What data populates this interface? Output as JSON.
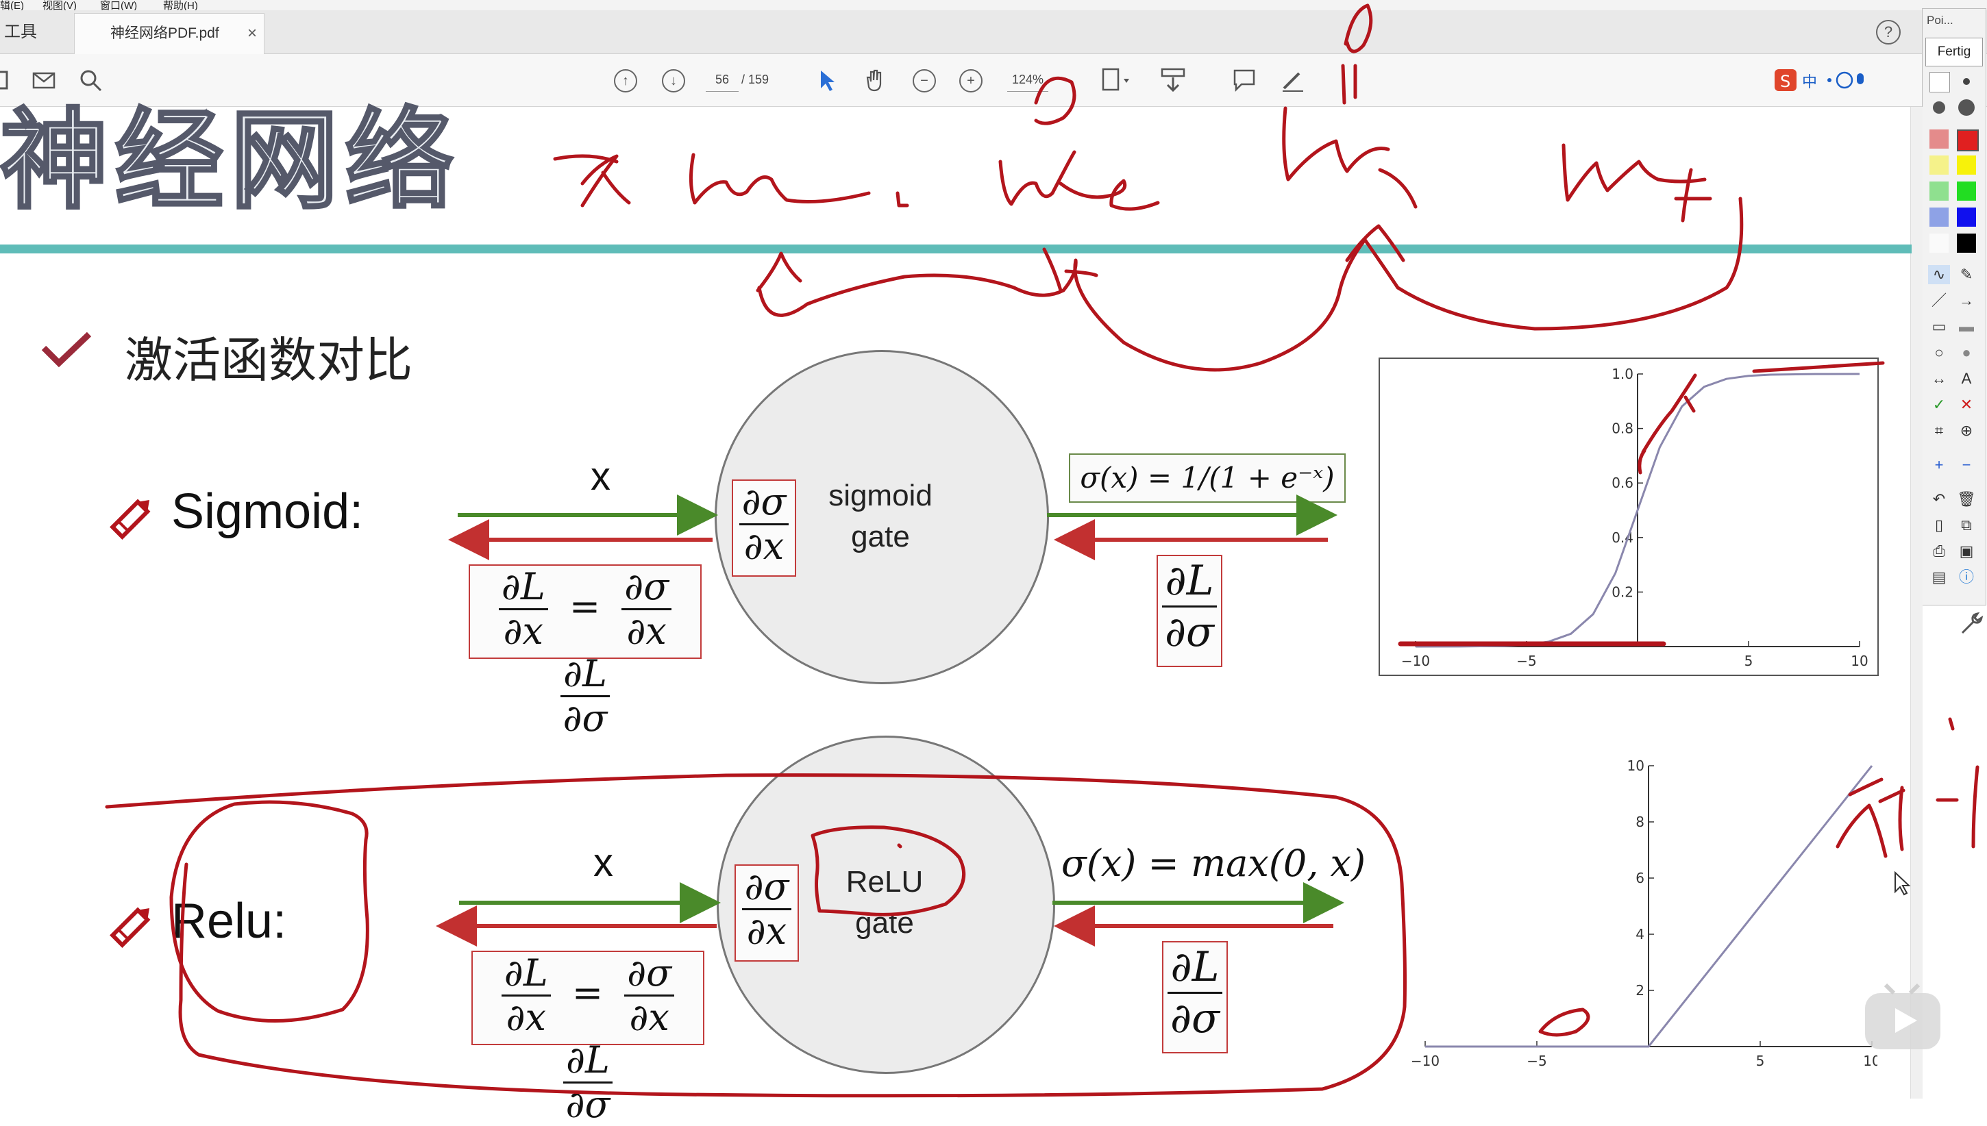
{
  "menubar": {
    "items": [
      "辑(E)",
      "视图(V)",
      "窗口(W)",
      "帮助(H)"
    ]
  },
  "tabs": {
    "tools": "工具",
    "document": "神经网络PDF.pdf",
    "close": "×",
    "help": "?"
  },
  "toolbar": {
    "current_page": "56",
    "page_sep": "/",
    "total_pages": "159",
    "zoom": "124%"
  },
  "annotation_panel": {
    "title": "Poi...",
    "done_button": "Fertig"
  },
  "slide": {
    "title": "神经网络",
    "section": "激活函数对比",
    "sigmoid": {
      "label": "Sigmoid:",
      "input": "x",
      "gate_line1": "sigmoid",
      "gate_line2": "gate",
      "formula": "σ(x) = 1/(1 + e⁻ˣ)",
      "local_grad_num": "∂σ",
      "local_grad_den": "∂x",
      "chain_lhs_num": "∂L",
      "chain_lhs_den": "∂x",
      "chain_eq": "=",
      "chain_r1_num": "∂σ",
      "chain_r1_den": "∂x",
      "chain_r2_num": "∂L",
      "chain_r2_den": "∂σ",
      "upstream_num": "∂L",
      "upstream_den": "∂σ"
    },
    "relu": {
      "label": "Relu:",
      "input": "x",
      "gate_line1": "ReLU",
      "gate_line2": "gate",
      "formula": "σ(x) = max(0, x)",
      "local_grad_num": "∂σ",
      "local_grad_den": "∂x",
      "chain_lhs_num": "∂L",
      "chain_lhs_den": "∂x",
      "chain_eq": "=",
      "chain_r1_num": "∂σ",
      "chain_r1_den": "∂x",
      "chain_r2_num": "∂L",
      "chain_r2_den": "∂σ",
      "upstream_num": "∂L",
      "upstream_den": "∂σ"
    }
  },
  "colors": {
    "forward_arrow": "#4a8a2a",
    "backward_arrow": "#c23030",
    "ink": "#b3151c",
    "teal": "#5fbcb8",
    "curve": "#8a87ad"
  },
  "chart_data": [
    {
      "type": "line",
      "title": "",
      "x_ticks": [
        -10,
        -5,
        5,
        10
      ],
      "y_ticks": [
        0.2,
        0.4,
        0.6,
        0.8,
        1.0
      ],
      "xlim": [
        -10,
        10
      ],
      "ylim": [
        0,
        1
      ],
      "series": [
        {
          "x": [
            -10,
            -8,
            -6,
            -5,
            -4,
            -3,
            -2,
            -1,
            0,
            1,
            2,
            3,
            4,
            5,
            6,
            8,
            10
          ],
          "y": [
            0.0,
            0.0003,
            0.0025,
            0.0067,
            0.018,
            0.047,
            0.119,
            0.269,
            0.5,
            0.731,
            0.881,
            0.953,
            0.982,
            0.993,
            0.9975,
            0.9997,
            1.0
          ]
        }
      ]
    },
    {
      "type": "line",
      "title": "",
      "x_ticks": [
        -10,
        -5,
        5,
        10
      ],
      "y_ticks": [
        2,
        4,
        6,
        8,
        10
      ],
      "xlim": [
        -10,
        10
      ],
      "ylim": [
        0,
        10
      ],
      "series": [
        {
          "x": [
            -10,
            0,
            10
          ],
          "y": [
            0,
            0,
            10
          ]
        }
      ]
    }
  ]
}
